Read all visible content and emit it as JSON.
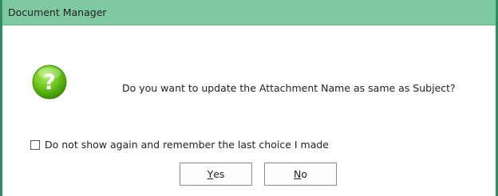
{
  "window": {
    "title": "Document Manager"
  },
  "dialog": {
    "icon": "question-icon",
    "message": "Do you want to update the Attachment Name as same as Subject?",
    "checkbox": {
      "label": "Do not show again and remember the last choice I made",
      "checked": false
    },
    "buttons": {
      "yes": {
        "mnemonic": "Y",
        "rest": "es"
      },
      "no": {
        "mnemonic": "N",
        "rest": "o"
      }
    }
  },
  "colors": {
    "titlebar": "#7fc9a2",
    "border": "#2f8f5e",
    "icon_green": "#5cb800"
  }
}
